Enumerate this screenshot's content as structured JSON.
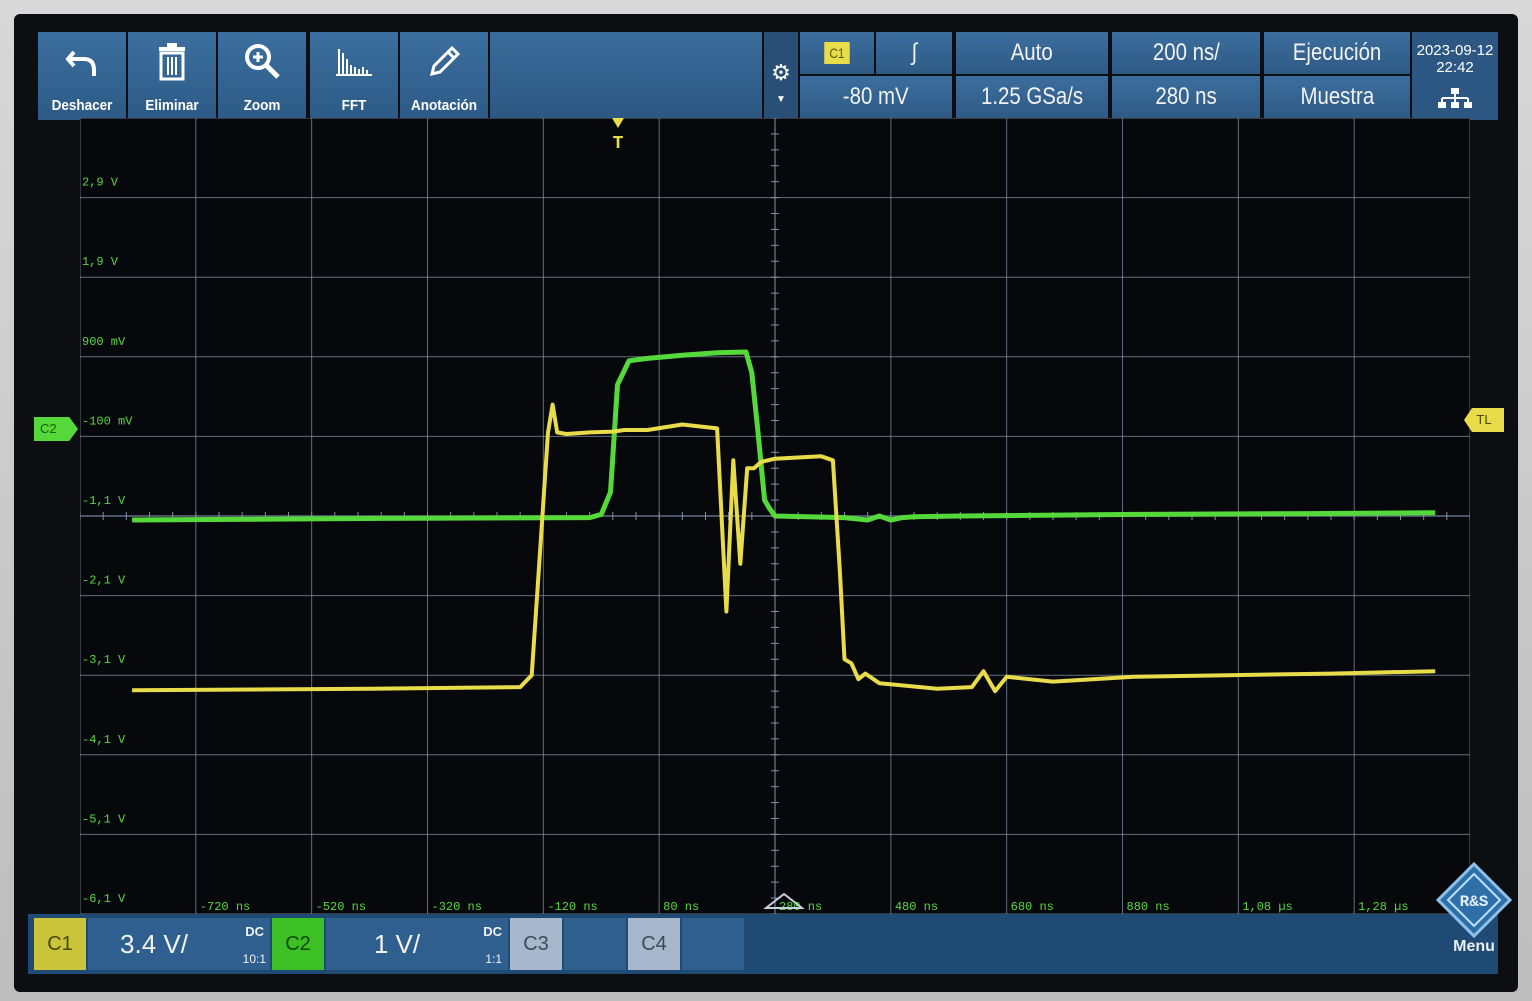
{
  "toolbar": {
    "undo": "Deshacer",
    "delete": "Eliminar",
    "zoom": "Zoom",
    "fft": "FFT",
    "annotation": "Anotación"
  },
  "trigger": {
    "source": "C1",
    "level": "-80 mV",
    "mode": "Auto",
    "sample_rate": "1.25 GSa/s",
    "time_scale": "200 ns/",
    "position": "280 ns",
    "run_state": "Ejecución",
    "acquisition": "Muestra"
  },
  "datetime": {
    "date": "2023-09-12",
    "time": "22:42"
  },
  "markers": {
    "channel": "C2",
    "trigger_level": "TL"
  },
  "y_labels": [
    "2,9 V",
    "1,9 V",
    "900 mV",
    "-100 mV",
    "-1,1 V",
    "-2,1 V",
    "-3,1 V",
    "-4,1 V",
    "-5,1 V",
    "-6,1 V"
  ],
  "x_labels": [
    "-720 ns",
    "-520 ns",
    "-320 ns",
    "-120 ns",
    "80 ns",
    "280 ns",
    "480 ns",
    "680 ns",
    "880 ns",
    "1,08 µs",
    "1,28 µs"
  ],
  "channels": {
    "c1": {
      "name": "C1",
      "scale": "3.4 V/",
      "coupling": "DC",
      "probe": "10:1"
    },
    "c2": {
      "name": "C2",
      "scale": "1 V/",
      "coupling": "DC",
      "probe": "1:1"
    },
    "c3": {
      "name": "C3"
    },
    "c4": {
      "name": "C4"
    }
  },
  "menu": {
    "label": "Menu",
    "logo_text": "R&S"
  },
  "colors": {
    "c1": "#e8dc4a",
    "c2": "#55d93a",
    "ui_blue": "#2e5a85",
    "grid": "#7f8fa8"
  },
  "chart_data": {
    "type": "line",
    "x_unit": "ns",
    "series": [
      {
        "name": "C1",
        "x": [
          -830,
          -420,
          -160,
          -140,
          -128,
          -112,
          -104,
          -96,
          -80,
          -40,
          0,
          20,
          60,
          120,
          180,
          196,
          208,
          220,
          232,
          244,
          256,
          280,
          360,
          380,
          392,
          400,
          412,
          424,
          436,
          460,
          560,
          620,
          640,
          660,
          680,
          760,
          900,
          1060,
          1240,
          1420
        ],
        "y": [
          -3.29,
          -3.27,
          -3.25,
          -3.1,
          -1.8,
          -0.05,
          0.3,
          -0.05,
          -0.07,
          -0.05,
          -0.04,
          -0.02,
          -0.02,
          0.05,
          0.0,
          -2.3,
          -0.4,
          -1.7,
          -0.5,
          -0.5,
          -0.42,
          -0.38,
          -0.35,
          -0.4,
          -1.8,
          -2.9,
          -2.95,
          -3.15,
          -3.08,
          -3.2,
          -3.27,
          -3.25,
          -3.05,
          -3.3,
          -3.12,
          -3.18,
          -3.12,
          -3.1,
          -3.08,
          -3.05
        ]
      },
      {
        "name": "C2",
        "x": [
          -830,
          -400,
          -40,
          -20,
          -4,
          8,
          28,
          60,
          120,
          180,
          230,
          240,
          250,
          262,
          270,
          280,
          400,
          440,
          460,
          480,
          500,
          520,
          600,
          900,
          1200,
          1420
        ],
        "y": [
          -1.15,
          -1.13,
          -1.12,
          -1.08,
          -0.8,
          0.55,
          0.85,
          0.88,
          0.92,
          0.95,
          0.96,
          0.7,
          0.0,
          -0.9,
          -1.0,
          -1.1,
          -1.12,
          -1.15,
          -1.1,
          -1.15,
          -1.12,
          -1.11,
          -1.1,
          -1.08,
          -1.07,
          -1.06
        ]
      }
    ],
    "grid": true
  }
}
